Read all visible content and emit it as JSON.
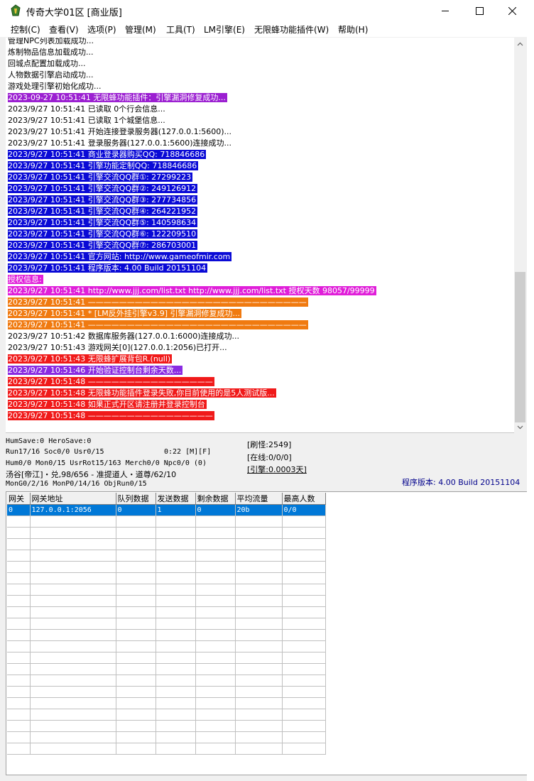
{
  "window": {
    "title": "传奇大学01区 [商业版]",
    "icon": "app-icon",
    "controls": [
      "minimize-icon",
      "maximize-icon",
      "close-icon"
    ]
  },
  "menu": [
    {
      "label": "控制(C)"
    },
    {
      "label": "查看(V)"
    },
    {
      "label": "选项(P)"
    },
    {
      "label": "管理(M)"
    },
    {
      "label": "工具(T)"
    },
    {
      "label": "LM引擎(E)"
    },
    {
      "label": "无限蜂功能插件(W)"
    },
    {
      "label": "帮助(H)"
    }
  ],
  "colors": {
    "purple": "#9b1fd1",
    "blue": "#0a0ad6",
    "magenta": "#e01fd9",
    "orange": "#f07a10",
    "red": "#f01a1a",
    "violet": "#8a2be2",
    "selection": "#0078d7"
  },
  "log": [
    {
      "text": "管理NPC列表加载成功...",
      "bg": "",
      "fg": "#000000"
    },
    {
      "text": "炼制物品信息加载成功...",
      "bg": "",
      "fg": "#000000"
    },
    {
      "text": "回城点配置加载成功...",
      "bg": "",
      "fg": "#000000"
    },
    {
      "text": "人物数据引擎启动成功...",
      "bg": "",
      "fg": "#000000"
    },
    {
      "text": "游戏处理引擎初始化成功...",
      "bg": "",
      "fg": "#000000"
    },
    {
      "text": "2023-09-27 10:51:41 无限蜂功能插件：引擎漏洞修复成功...",
      "bg": "#9b1fd1",
      "fg": "#ffffff"
    },
    {
      "text": "2023/9/27 10:51:41 已读取 0个行会信息...",
      "bg": "",
      "fg": "#000000"
    },
    {
      "text": "2023/9/27 10:51:41 已读取 1个城堡信息...",
      "bg": "",
      "fg": "#000000"
    },
    {
      "text": "2023/9/27 10:51:41 开始连接登录服务器(127.0.0.1:5600)...",
      "bg": "",
      "fg": "#000000"
    },
    {
      "text": "2023/9/27 10:51:41 登录服务器(127.0.0.1:5600)连接成功...",
      "bg": "",
      "fg": "#000000"
    },
    {
      "text": "2023/9/27 10:51:41 商业登录器购买QQ: 718846686",
      "bg": "#0a0ad6",
      "fg": "#ffffff"
    },
    {
      "text": "2023/9/27 10:51:41 引擎功能定制QQ: 718846686",
      "bg": "#0a0ad6",
      "fg": "#ffffff"
    },
    {
      "text": "2023/9/27 10:51:41 引擎交流QQ群①: 27299223",
      "bg": "#0a0ad6",
      "fg": "#ffffff"
    },
    {
      "text": "2023/9/27 10:51:41 引擎交流QQ群②: 249126912",
      "bg": "#0a0ad6",
      "fg": "#ffffff"
    },
    {
      "text": "2023/9/27 10:51:41 引擎交流QQ群③: 277734856",
      "bg": "#0a0ad6",
      "fg": "#ffffff"
    },
    {
      "text": "2023/9/27 10:51:41 引擎交流QQ群④: 264221952",
      "bg": "#0a0ad6",
      "fg": "#ffffff"
    },
    {
      "text": "2023/9/27 10:51:41 引擎交流QQ群⑤: 140598634",
      "bg": "#0a0ad6",
      "fg": "#ffffff"
    },
    {
      "text": "2023/9/27 10:51:41 引擎交流QQ群⑥: 122209510",
      "bg": "#0a0ad6",
      "fg": "#ffffff"
    },
    {
      "text": "2023/9/27 10:51:41 引擎交流QQ群⑦: 286703001",
      "bg": "#0a0ad6",
      "fg": "#ffffff"
    },
    {
      "text": "2023/9/27 10:51:41 官方网站: http://www.gameofmir.com",
      "bg": "#0a0ad6",
      "fg": "#ffffff"
    },
    {
      "text": "2023/9/27 10:51:41 程序版本: 4.00 Build 20151104",
      "bg": "#0a0ad6",
      "fg": "#ffffff"
    },
    {
      "text": "授权信息:",
      "bg": "#e01fd9",
      "fg": "#ffffff"
    },
    {
      "text": "2023/9/27 10:51:41 http://www.jjj.com/list.txt http://www.jjj.com/list.txt 授权天数 98057/99999",
      "bg": "#e01fd9",
      "fg": "#ffffff"
    },
    {
      "text": "2023/9/27 10:51:41 ————————————————————————————",
      "bg": "#f07a10",
      "fg": "#ffffff"
    },
    {
      "text": "2023/9/27 10:51:41 * [LM反外挂引擎v3.9] 引擎漏洞修复成功...",
      "bg": "#f07a10",
      "fg": "#ffffff"
    },
    {
      "text": "2023/9/27 10:51:41 ————————————————————————————",
      "bg": "#f07a10",
      "fg": "#ffffff"
    },
    {
      "text": "2023/9/27 10:51:42 数据库服务器(127.0.0.1:6000)连接成功...",
      "bg": "",
      "fg": "#000000"
    },
    {
      "text": "2023/9/27 10:51:43 游戏网关[0](127.0.0.1:2056)已打开...",
      "bg": "",
      "fg": "#000000"
    },
    {
      "text": "2023/9/27 10:51:43 无限蜂扩展背包R.(null)",
      "bg": "#f01a1a",
      "fg": "#ffffff"
    },
    {
      "text": "2023/9/27 10:51:46 开始验证控制台剩余天数...",
      "bg": "#8a2be2",
      "fg": "#ffffff"
    },
    {
      "text": "2023/9/27 10:51:48 ————————————————",
      "bg": "#f01a1a",
      "fg": "#ffffff"
    },
    {
      "text": "2023/9/27 10:51:48 无限蜂功能插件登录失败,你目前使用的是5人测试版...",
      "bg": "#f01a1a",
      "fg": "#ffffff"
    },
    {
      "text": "2023/9/27 10:51:48 如果正式开区请注册并登录控制台",
      "bg": "#f01a1a",
      "fg": "#ffffff"
    },
    {
      "text": "2023/9/27 10:51:48 ————————————————",
      "bg": "#f01a1a",
      "fg": "#ffffff"
    }
  ],
  "status": {
    "line1": "HumSave:0 HeroSave:0",
    "line2": "Run17/16 Soc0/0 Usr0/15",
    "timer": "0:22 [M][F]",
    "line3": "Hum0/0 Mon0/15 UsrRot15/163 Merch0/0 Npc0/0 (0)",
    "line4": "汤谷[帝江]・兑,98/656 - 准提道人・道尊/62/10",
    "line5": "MonG0/2/16 MonP0/14/16 ObjRun0/15",
    "refresh": "[刷怪:2549]",
    "online": "[在线:0/0/0]",
    "engine": "[引擎:0.0003天]",
    "version": "程序版本: 4.00 Build 20151104"
  },
  "grid": {
    "headers": [
      "网关",
      "网关地址",
      "队列数据",
      "发送数据",
      "剩余数据",
      "平均流量",
      "最高人数"
    ],
    "rows": [
      [
        "0",
        "127.0.0.1:2056",
        "0",
        "1",
        "0",
        "20b",
        "0/0"
      ]
    ]
  }
}
